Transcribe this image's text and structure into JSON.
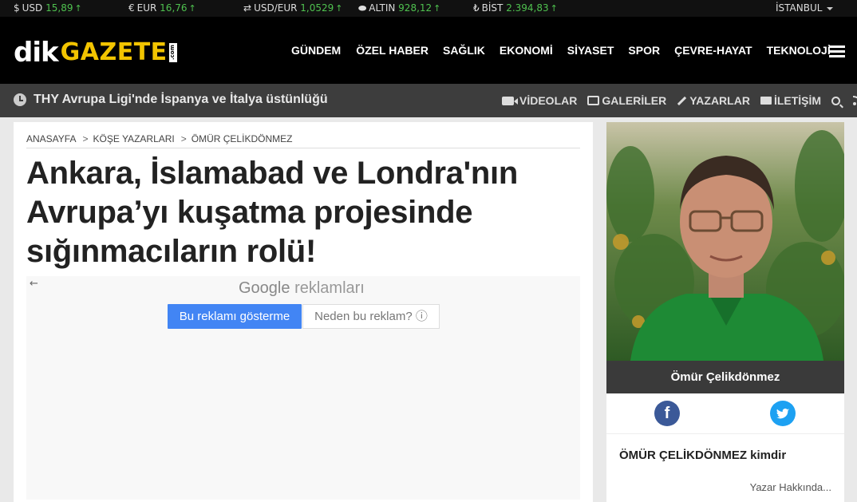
{
  "ticker": [
    {
      "symbol": "$",
      "label": "USD",
      "value": "15,89",
      "trend": "↑"
    },
    {
      "symbol": "€",
      "label": "EUR",
      "value": "16,76",
      "trend": "↑"
    },
    {
      "symbol": "⇄",
      "label": "USD/EUR",
      "value": "1,0529",
      "trend": "↑"
    },
    {
      "symbol": "⬬",
      "label": "ALTIN",
      "value": "928,12",
      "trend": "↑"
    },
    {
      "symbol": "₺",
      "label": "BİST",
      "value": "2.394,83",
      "trend": "↑"
    }
  ],
  "city": "İSTANBUL",
  "logo": {
    "dik": "dik",
    "gazete": "GAZETE",
    "com": ".com"
  },
  "nav": [
    "GÜNDEM",
    "ÖZEL HABER",
    "SAĞLIK",
    "EKONOMİ",
    "SİYASET",
    "SPOR",
    "ÇEVRE-HAYAT",
    "TEKNOLOJİ"
  ],
  "breaking": "THY Avrupa Ligi'nde İspanya ve İtalya üstünlüğü",
  "sublinks": [
    "VİDEOLAR",
    "GALERİLER",
    "YAZARLAR",
    "İLETİŞİM"
  ],
  "breadcrumb": [
    "ANASAYFA",
    "KÖŞE YAZARLARI",
    "ÖMÜR ÇELİKDÖNMEZ"
  ],
  "breadcrumb_sep": ">",
  "article": {
    "title": "Ankara, İslamabad ve Londra'nın Avrupa’yı kuşatma projesinde sığınmacıların rolü!"
  },
  "ad": {
    "back": "←",
    "brand": "Google",
    "brand_suffix": "reklamları",
    "stop_label": "Bu reklamı gösterme",
    "why_label": "Neden bu reklam? ⓘ"
  },
  "author": {
    "name": "Ömür Çelikdönmez",
    "facebook": "f",
    "about_title": "ÖMÜR ÇELİKDÖNMEZ kimdir",
    "about_more": "Yazar Hakkında..."
  },
  "colors": {
    "accent_green": "#4fc14f",
    "logo_yellow": "#f2c400",
    "facebook": "#3b5998",
    "twitter": "#1da1f2",
    "ad_button": "#4285f4"
  }
}
